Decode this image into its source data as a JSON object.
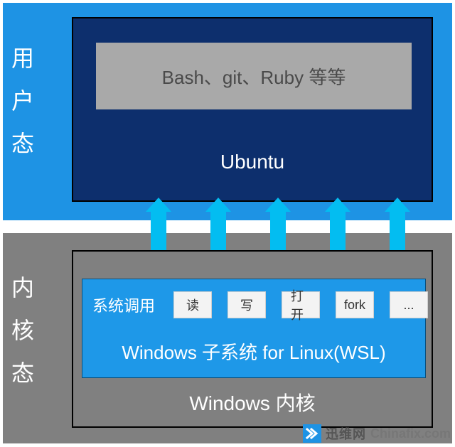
{
  "sections": {
    "user_mode_label": "用户态",
    "kernel_mode_label": "内核态"
  },
  "ubuntu": {
    "tools_line": "Bash、git、Ruby 等等",
    "name": "Ubuntu"
  },
  "wsl": {
    "syscall_label": "系统调用",
    "chips": {
      "read": "读",
      "write": "写",
      "open": "打开",
      "fork": "fork",
      "more": "..."
    },
    "title": "Windows 子系统 for Linux(WSL)"
  },
  "kernel": {
    "title": "Windows 内核"
  },
  "watermark": {
    "cn": "迅维网",
    "en": "Chinafix.com"
  },
  "arrow_xs": [
    223,
    307,
    391,
    475,
    559
  ]
}
